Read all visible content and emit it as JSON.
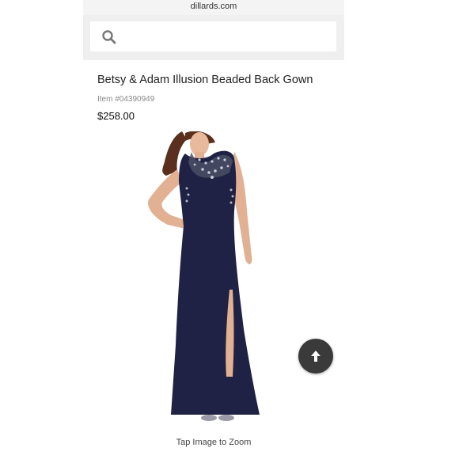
{
  "browser": {
    "url": "dillards.com"
  },
  "search": {
    "placeholder": ""
  },
  "product": {
    "title": "Betsy & Adam Illusion Beaded Back Gown",
    "item_number": "Item #04390949",
    "price": "$258.00",
    "image_caption": "Tap Image to Zoom"
  },
  "icons": {
    "search": "search-icon",
    "back_to_top": "arrow-up-icon"
  },
  "colors": {
    "gown": "#1f2244",
    "button": "#3a3a3a"
  }
}
